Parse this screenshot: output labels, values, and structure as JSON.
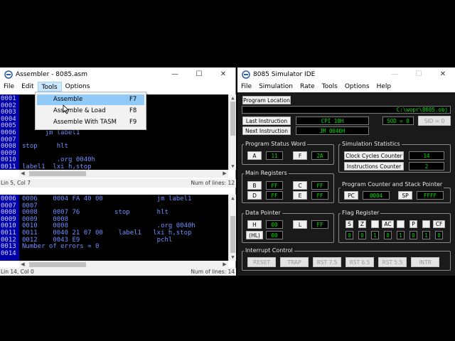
{
  "assembler": {
    "title": "Assembler - 8085.asm",
    "window_controls": {
      "minimize": "—",
      "maximize": "☐",
      "close": "✕"
    },
    "menu": [
      "File",
      "Edit",
      "Tools",
      "Options"
    ],
    "tools_menu": [
      {
        "label": "Assemble",
        "shortcut": "F7"
      },
      {
        "label": "Assemble & Load",
        "shortcut": "F8"
      },
      {
        "label": "Assemble With TASM",
        "shortcut": "F9"
      }
    ],
    "top_editor": {
      "lines": [
        {
          "num": "0001",
          "code": ""
        },
        {
          "num": "0002",
          "code": ""
        },
        {
          "num": "0003",
          "code": ""
        },
        {
          "num": "0004",
          "code": "                        e jp jm"
        },
        {
          "num": "0005",
          "code": ""
        },
        {
          "num": "0006",
          "code": "      jm label1"
        },
        {
          "num": "0007",
          "code": ""
        },
        {
          "num": "0008",
          "code": "stop     hlt"
        },
        {
          "num": "0009",
          "code": ""
        },
        {
          "num": "0010",
          "code": "         .org 0040h"
        },
        {
          "num": "0011",
          "code": "label1  lxi h,stop"
        }
      ]
    },
    "top_status": {
      "position": "Lin 5, Col 7",
      "lines": "Num of lines: 12"
    },
    "bottom_editor": {
      "lines": [
        {
          "num": "0006",
          "code": "0006    0004 FA 40 00              jm label1"
        },
        {
          "num": "0007",
          "code": "0007"
        },
        {
          "num": "0008",
          "code": "0008    0007 76         stop       hlt"
        },
        {
          "num": "0009",
          "code": "0009    0008"
        },
        {
          "num": "0010",
          "code": "0010    0008                       .org 0040h"
        },
        {
          "num": "0011",
          "code": "0011    0040 21 07 00    label1   lxi h,stop"
        },
        {
          "num": "0012",
          "code": "0012    0043 E9                    pchl"
        },
        {
          "num": "0013",
          "code": "Number of errors = 0"
        },
        {
          "num": "0014",
          "code": ""
        }
      ]
    },
    "bottom_status": {
      "position": "Lin 14, Col 0",
      "lines": "Num of lines: 14"
    }
  },
  "simulator": {
    "title": "8085 Simulator IDE",
    "menu": [
      "File",
      "Simulation",
      "Rate",
      "Tools",
      "Options",
      "Help"
    ],
    "program_location_button": "Program Location",
    "program_path": "C:\\wopr\\8085.obj",
    "last_instruction_label": "Last Instruction",
    "last_instruction_value": "CPI 10H",
    "next_instruction_label": "Next Instruction",
    "next_instruction_value": "JM 0040H",
    "sod_value": "SOD = 0",
    "sid_button": "SID = 0",
    "psw": {
      "title": "Program Status Word",
      "a_label": "A",
      "a_value": "11",
      "f_label": "F",
      "f_value": "2A"
    },
    "stats": {
      "title": "Simulation Statistics",
      "clock_label": "Clock Cycles Counter",
      "clock_value": "14",
      "instr_label": "Instructions Counter",
      "instr_value": "2"
    },
    "main_regs": {
      "title": "Main Registers",
      "regs": [
        {
          "label": "B",
          "value": "FF"
        },
        {
          "label": "C",
          "value": "FF"
        },
        {
          "label": "D",
          "value": "FF"
        },
        {
          "label": "E",
          "value": "FF"
        }
      ]
    },
    "pc_sp": {
      "title": "Program Counter and Stack Pointer",
      "pc_label": "PC",
      "pc_value": "0004",
      "sp_label": "SP",
      "sp_value": "FFFF"
    },
    "data_pointer": {
      "title": "Data Pointer",
      "h_label": "H",
      "h_value": "00",
      "l_label": "L",
      "l_value": "FF",
      "hl_label": "(HL)",
      "hl_value": "00"
    },
    "flags": {
      "title": "Flag Register",
      "labels": [
        "S",
        "Z",
        "",
        "AC",
        "",
        "P",
        "",
        "CF"
      ],
      "values": [
        "0",
        "0",
        "1",
        "0",
        "1",
        "0",
        "1",
        "0"
      ]
    },
    "interrupts": {
      "title": "Interrupt Control",
      "buttons": [
        "RESET",
        "TRAP",
        "RST 7.5",
        "RST 6.5",
        "RST 5.5",
        "INTR"
      ]
    }
  }
}
